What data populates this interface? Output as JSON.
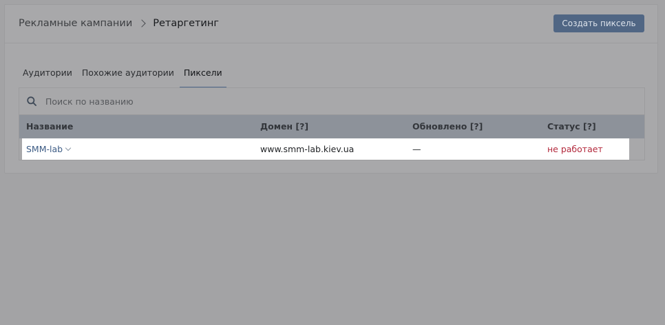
{
  "header": {
    "breadcrumb_parent": "Рекламные кампании",
    "breadcrumb_current": "Ретаргетинг",
    "create_button": "Создать пиксель"
  },
  "tabs": [
    {
      "label": "Аудитории",
      "active": false
    },
    {
      "label": "Похожие аудитории",
      "active": false
    },
    {
      "label": "Пиксели",
      "active": true
    }
  ],
  "search": {
    "placeholder": "Поиск по названию",
    "value": ""
  },
  "table": {
    "columns": [
      "Название",
      "Домен [?]",
      "Обновлено [?]",
      "Статус [?]"
    ],
    "rows": [
      {
        "name": "SMM-lab",
        "domain": "www.smm-lab.kiev.ua",
        "updated": "—",
        "status": "не работает"
      }
    ]
  },
  "colors": {
    "accent": "#506684",
    "status_error": "#b3293c",
    "link": "#3d5c85"
  },
  "icons": [
    "search-icon",
    "chevron-right-icon",
    "chevron-down-icon"
  ]
}
